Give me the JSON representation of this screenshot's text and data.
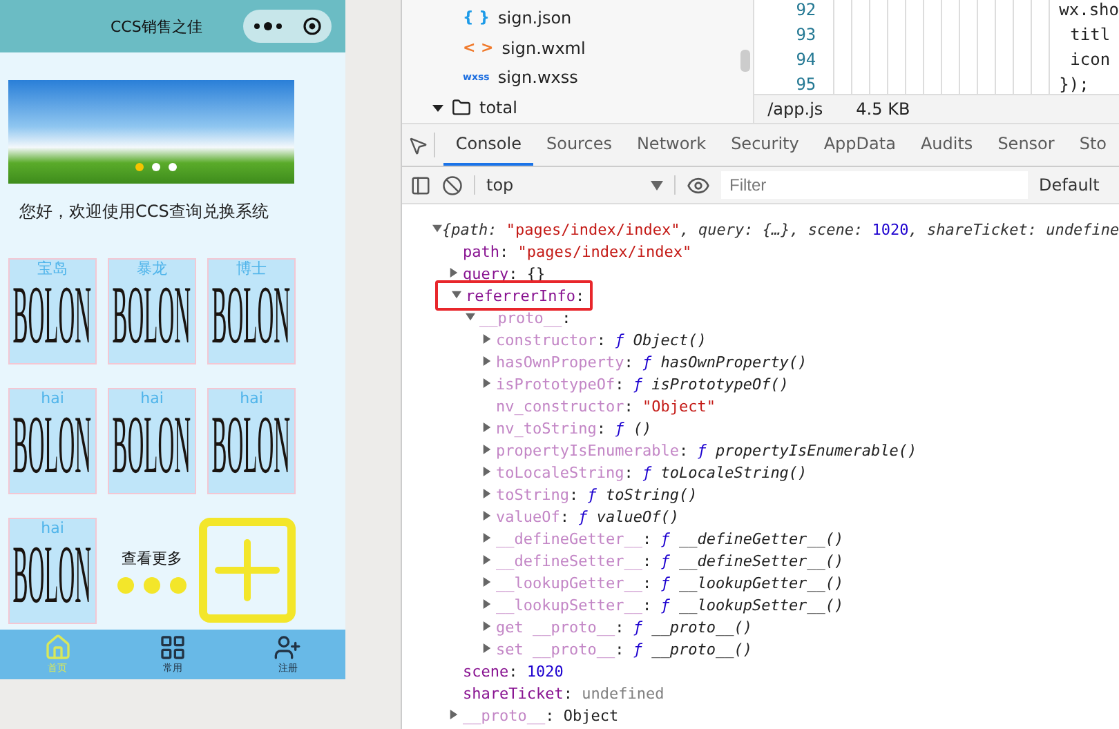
{
  "phone": {
    "nav_title": "CCS销售之佳",
    "banner": {
      "dots": [
        {
          "selected": true
        },
        {
          "selected": false
        },
        {
          "selected": false
        }
      ]
    },
    "greeting": "您好，欢迎使用CCS查询兑换系统",
    "cards": [
      {
        "label": "宝岛",
        "logo": "BOLON"
      },
      {
        "label": "暴龙",
        "logo": "BOLON"
      },
      {
        "label": "博士",
        "logo": "BOLON"
      },
      {
        "label": "hai",
        "logo": "BOLON"
      },
      {
        "label": "hai",
        "logo": "BOLON"
      },
      {
        "label": "hai",
        "logo": "BOLON"
      },
      {
        "label": "hai",
        "logo": "BOLON"
      }
    ],
    "more_label": "查看更多",
    "tabbar": [
      {
        "label": "首页",
        "selected": true
      },
      {
        "label": "常用",
        "selected": false
      },
      {
        "label": "注册",
        "selected": false
      }
    ]
  },
  "file_tree": [
    {
      "name": "sign.json",
      "kind": "json",
      "badge": "{ }"
    },
    {
      "name": "sign.wxml",
      "kind": "wxml",
      "badge": "< >"
    },
    {
      "name": "sign.wxss",
      "kind": "wxss",
      "badge": "wxss"
    },
    {
      "name": "total",
      "kind": "folder",
      "expanded": true
    }
  ],
  "editor": {
    "lines": [
      {
        "number": "92",
        "code": "wx.sho"
      },
      {
        "number": "93",
        "code": "titl"
      },
      {
        "number": "94",
        "code": "icon"
      },
      {
        "number": "95",
        "code": "});"
      }
    ],
    "status": {
      "path": "/app.js",
      "size": "4.5 KB"
    }
  },
  "devtools_tabs": [
    {
      "label": "Console",
      "selected": true
    },
    {
      "label": "Sources",
      "selected": false
    },
    {
      "label": "Network",
      "selected": false
    },
    {
      "label": "Security",
      "selected": false
    },
    {
      "label": "AppData",
      "selected": false
    },
    {
      "label": "Audits",
      "selected": false
    },
    {
      "label": "Sensor",
      "selected": false
    },
    {
      "label": "Sto",
      "selected": false
    }
  ],
  "console_toolbar": {
    "context": "top",
    "filter_placeholder": "Filter",
    "levels": "Default"
  },
  "console": [
    {
      "expanded": true,
      "parts": [
        {
          "text": "{",
          "kind": "summary"
        },
        {
          "text": "path: ",
          "kind": "summary"
        },
        {
          "text": "\"pages/index/index\"",
          "kind": "string"
        },
        {
          "text": ", query: {…}, scene: ",
          "kind": "summary"
        },
        {
          "text": "1020",
          "kind": "number"
        },
        {
          "text": ", shareTicket: undefine",
          "kind": "summary"
        }
      ],
      "children": [
        {
          "parts": [
            {
              "text": "path",
              "kind": "key"
            },
            {
              "text": ": ",
              "kind": "plain"
            },
            {
              "text": "\"pages/index/index\"",
              "kind": "string"
            }
          ]
        },
        {
          "expanded": false,
          "parts": [
            {
              "text": "query",
              "kind": "key"
            },
            {
              "text": ": {}",
              "kind": "plain"
            }
          ]
        },
        {
          "expanded": true,
          "highlighted": true,
          "parts": [
            {
              "text": "referrerInfo",
              "kind": "key"
            },
            {
              "text": ":",
              "kind": "plain"
            }
          ],
          "children": [
            {
              "expanded": true,
              "parts": [
                {
                  "text": "__proto__",
                  "kind": "proto"
                },
                {
                  "text": ":",
                  "kind": "plain"
                }
              ],
              "children": [
                {
                  "expanded": false,
                  "parts": [
                    {
                      "text": "constructor",
                      "kind": "proto"
                    },
                    {
                      "text": ": ",
                      "kind": "plain"
                    },
                    {
                      "text": "ƒ ",
                      "kind": "f"
                    },
                    {
                      "text": "Object()",
                      "kind": "function"
                    }
                  ]
                },
                {
                  "expanded": false,
                  "parts": [
                    {
                      "text": "hasOwnProperty",
                      "kind": "proto"
                    },
                    {
                      "text": ": ",
                      "kind": "plain"
                    },
                    {
                      "text": "ƒ ",
                      "kind": "f"
                    },
                    {
                      "text": "hasOwnProperty()",
                      "kind": "function"
                    }
                  ]
                },
                {
                  "expanded": false,
                  "parts": [
                    {
                      "text": "isPrototypeOf",
                      "kind": "proto"
                    },
                    {
                      "text": ": ",
                      "kind": "plain"
                    },
                    {
                      "text": "ƒ ",
                      "kind": "f"
                    },
                    {
                      "text": "isPrototypeOf()",
                      "kind": "function"
                    }
                  ]
                },
                {
                  "parts": [
                    {
                      "text": "nv_constructor",
                      "kind": "proto"
                    },
                    {
                      "text": ": ",
                      "kind": "plain"
                    },
                    {
                      "text": "\"Object\"",
                      "kind": "string"
                    }
                  ]
                },
                {
                  "expanded": false,
                  "parts": [
                    {
                      "text": "nv_toString",
                      "kind": "proto"
                    },
                    {
                      "text": ": ",
                      "kind": "plain"
                    },
                    {
                      "text": "ƒ ",
                      "kind": "f"
                    },
                    {
                      "text": "()",
                      "kind": "function"
                    }
                  ]
                },
                {
                  "expanded": false,
                  "parts": [
                    {
                      "text": "propertyIsEnumerable",
                      "kind": "proto"
                    },
                    {
                      "text": ": ",
                      "kind": "plain"
                    },
                    {
                      "text": "ƒ ",
                      "kind": "f"
                    },
                    {
                      "text": "propertyIsEnumerable()",
                      "kind": "function"
                    }
                  ]
                },
                {
                  "expanded": false,
                  "parts": [
                    {
                      "text": "toLocaleString",
                      "kind": "proto"
                    },
                    {
                      "text": ": ",
                      "kind": "plain"
                    },
                    {
                      "text": "ƒ ",
                      "kind": "f"
                    },
                    {
                      "text": "toLocaleString()",
                      "kind": "function"
                    }
                  ]
                },
                {
                  "expanded": false,
                  "parts": [
                    {
                      "text": "toString",
                      "kind": "proto"
                    },
                    {
                      "text": ": ",
                      "kind": "plain"
                    },
                    {
                      "text": "ƒ ",
                      "kind": "f"
                    },
                    {
                      "text": "toString()",
                      "kind": "function"
                    }
                  ]
                },
                {
                  "expanded": false,
                  "parts": [
                    {
                      "text": "valueOf",
                      "kind": "proto"
                    },
                    {
                      "text": ": ",
                      "kind": "plain"
                    },
                    {
                      "text": "ƒ ",
                      "kind": "f"
                    },
                    {
                      "text": "valueOf()",
                      "kind": "function"
                    }
                  ]
                },
                {
                  "expanded": false,
                  "parts": [
                    {
                      "text": "__defineGetter__",
                      "kind": "proto"
                    },
                    {
                      "text": ": ",
                      "kind": "plain"
                    },
                    {
                      "text": "ƒ ",
                      "kind": "f"
                    },
                    {
                      "text": "__defineGetter__()",
                      "kind": "function"
                    }
                  ]
                },
                {
                  "expanded": false,
                  "parts": [
                    {
                      "text": "__defineSetter__",
                      "kind": "proto"
                    },
                    {
                      "text": ": ",
                      "kind": "plain"
                    },
                    {
                      "text": "ƒ ",
                      "kind": "f"
                    },
                    {
                      "text": "__defineSetter__()",
                      "kind": "function"
                    }
                  ]
                },
                {
                  "expanded": false,
                  "parts": [
                    {
                      "text": "__lookupGetter__",
                      "kind": "proto"
                    },
                    {
                      "text": ": ",
                      "kind": "plain"
                    },
                    {
                      "text": "ƒ ",
                      "kind": "f"
                    },
                    {
                      "text": "__lookupGetter__()",
                      "kind": "function"
                    }
                  ]
                },
                {
                  "expanded": false,
                  "parts": [
                    {
                      "text": "__lookupSetter__",
                      "kind": "proto"
                    },
                    {
                      "text": ": ",
                      "kind": "plain"
                    },
                    {
                      "text": "ƒ ",
                      "kind": "f"
                    },
                    {
                      "text": "__lookupSetter__()",
                      "kind": "function"
                    }
                  ]
                },
                {
                  "expanded": false,
                  "parts": [
                    {
                      "text": "get __proto__",
                      "kind": "proto"
                    },
                    {
                      "text": ": ",
                      "kind": "plain"
                    },
                    {
                      "text": "ƒ ",
                      "kind": "f"
                    },
                    {
                      "text": "__proto__()",
                      "kind": "function"
                    }
                  ]
                },
                {
                  "expanded": false,
                  "parts": [
                    {
                      "text": "set __proto__",
                      "kind": "proto"
                    },
                    {
                      "text": ": ",
                      "kind": "plain"
                    },
                    {
                      "text": "ƒ ",
                      "kind": "f"
                    },
                    {
                      "text": "__proto__()",
                      "kind": "function"
                    }
                  ]
                }
              ]
            }
          ]
        },
        {
          "parts": [
            {
              "text": "scene",
              "kind": "key"
            },
            {
              "text": ": ",
              "kind": "plain"
            },
            {
              "text": "1020",
              "kind": "number"
            }
          ]
        },
        {
          "parts": [
            {
              "text": "shareTicket",
              "kind": "key"
            },
            {
              "text": ": ",
              "kind": "plain"
            },
            {
              "text": "undefined",
              "kind": "undefined"
            }
          ]
        },
        {
          "expanded": false,
          "parts": [
            {
              "text": "__proto__",
              "kind": "proto"
            },
            {
              "text": ": ",
              "kind": "plain"
            },
            {
              "text": "Object",
              "kind": "plain"
            }
          ]
        }
      ]
    }
  ]
}
